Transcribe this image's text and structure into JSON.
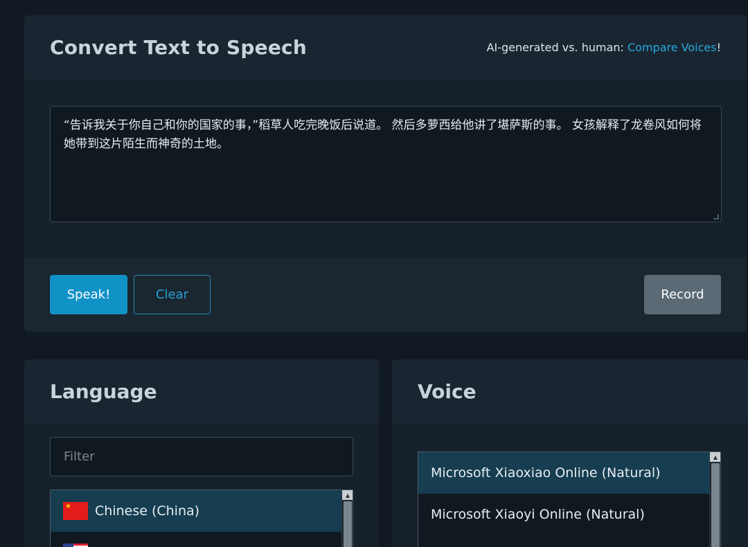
{
  "tts": {
    "title": "Convert Text to Speech",
    "compare_prefix": "AI-generated vs. human:",
    "compare_link": "Compare Voices",
    "compare_suffix": "!",
    "text": "“告诉我关于你自己和你的国家的事，”稻草人吃完晚饭后说道。 然后多萝西给他讲了堪萨斯的事。 女孩解释了龙卷风如何将她带到这片陌生而神奇的土地。",
    "speak_label": "Speak!",
    "clear_label": "Clear",
    "record_label": "Record"
  },
  "language": {
    "title": "Language",
    "filter_placeholder": "Filter",
    "items": [
      {
        "label": "Chinese (China)",
        "flag": "cn-flag-icon",
        "selected": true
      },
      {
        "label": "",
        "flag": "us-flag-icon",
        "selected": false
      }
    ]
  },
  "voice": {
    "title": "Voice",
    "items": [
      {
        "label": "Microsoft Xiaoxiao Online (Natural)",
        "selected": true
      },
      {
        "label": "Microsoft Xiaoyi Online (Natural)",
        "selected": false
      }
    ]
  },
  "colors": {
    "accent": "#1192c6",
    "link": "#27a9e1",
    "selected_row": "#163d50",
    "background": "#111a22"
  }
}
